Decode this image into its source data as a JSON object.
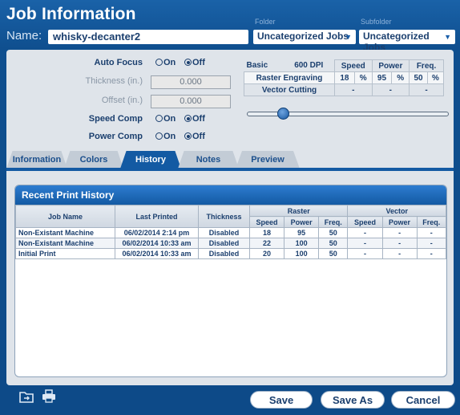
{
  "window": {
    "title": "Job Information"
  },
  "job": {
    "name_label": "Name:",
    "name_value": "whisky-decanter2"
  },
  "folder": {
    "label": "Folder",
    "value": "Uncategorized Jobs"
  },
  "subfolder": {
    "label": "Subfolder",
    "value": "Uncategorized Jobs"
  },
  "options": {
    "auto_focus": {
      "label": "Auto Focus",
      "on": "On",
      "off": "Off",
      "selected": "Off"
    },
    "thickness": {
      "label": "Thickness (in.)",
      "value": "0.000"
    },
    "offset": {
      "label": "Offset (in.)",
      "value": "0.000"
    },
    "speed_comp": {
      "label": "Speed Comp",
      "on": "On",
      "off": "Off",
      "selected": "Off"
    },
    "power_comp": {
      "label": "Power Comp",
      "on": "On",
      "off": "Off",
      "selected": "Off"
    }
  },
  "settings": {
    "mode": "Basic",
    "dpi": "600 DPI",
    "headers": [
      "Speed",
      "Power",
      "Freq."
    ],
    "raster": {
      "label": "Raster Engraving",
      "speed": "18",
      "power": "95",
      "freq": "50",
      "unit": "%"
    },
    "vector": {
      "label": "Vector Cutting",
      "speed": "-",
      "power": "-",
      "freq": "-"
    }
  },
  "tabs": [
    "Information",
    "Colors",
    "History",
    "Notes",
    "Preview"
  ],
  "active_tab": "History",
  "history": {
    "title": "Recent Print History",
    "columns": {
      "job_name": "Job Name",
      "last_printed": "Last Printed",
      "thickness": "Thickness",
      "raster": "Raster",
      "vector": "Vector",
      "speed": "Speed",
      "power": "Power",
      "freq": "Freq."
    },
    "rows": [
      {
        "job": "Non-Existant Machine",
        "date": "06/02/2014 2:14 pm",
        "thickness": "Disabled",
        "r_speed": "18",
        "r_power": "95",
        "r_freq": "50",
        "v_speed": "-",
        "v_power": "-",
        "v_freq": "-"
      },
      {
        "job": "Non-Existant Machine",
        "date": "06/02/2014 10:33 am",
        "thickness": "Disabled",
        "r_speed": "22",
        "r_power": "100",
        "r_freq": "50",
        "v_speed": "-",
        "v_power": "-",
        "v_freq": "-"
      },
      {
        "job": "Initial Print",
        "date": "06/02/2014 10:33 am",
        "thickness": "Disabled",
        "r_speed": "20",
        "r_power": "100",
        "r_freq": "50",
        "v_speed": "-",
        "v_power": "-",
        "v_freq": "-"
      }
    ]
  },
  "buttons": {
    "save": "Save",
    "save_as": "Save As",
    "cancel": "Cancel"
  },
  "icons": {
    "folder": "folder-import-icon",
    "print": "printer-icon"
  },
  "colors": {
    "accent": "#135aa3",
    "background": "#0e4c86",
    "panel": "#dfe4ea"
  }
}
